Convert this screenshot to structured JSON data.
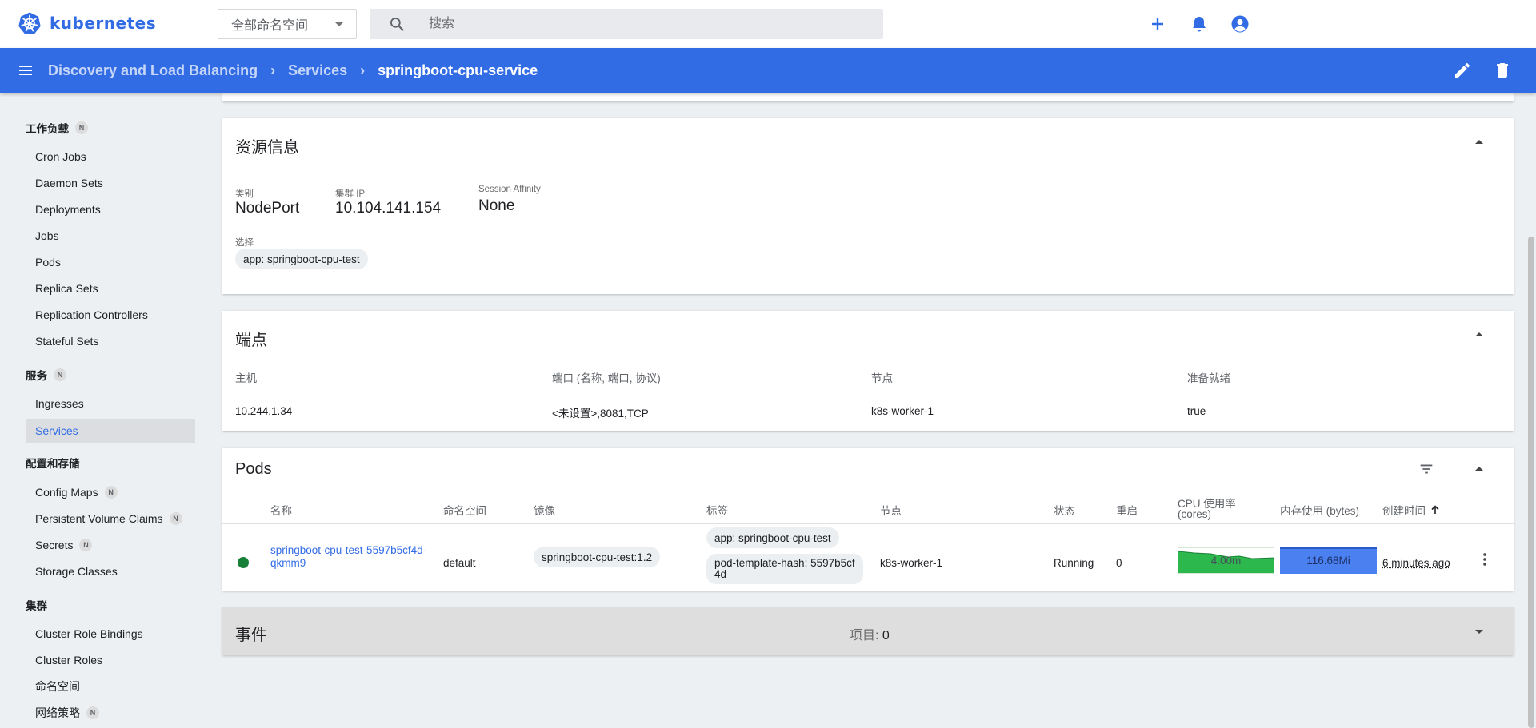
{
  "app": {
    "logo_text": "kubernetes"
  },
  "topbar": {
    "namespace_select": "全部命名空间",
    "search_placeholder": "搜索"
  },
  "breadcrumb": {
    "items": [
      "Discovery and Load Balancing",
      "Services"
    ],
    "current": "springboot-cpu-service"
  },
  "sidebar": {
    "workloads": {
      "title": "工作负载",
      "badge": "N",
      "items": [
        "Cron Jobs",
        "Daemon Sets",
        "Deployments",
        "Jobs",
        "Pods",
        "Replica Sets",
        "Replication Controllers",
        "Stateful Sets"
      ]
    },
    "service": {
      "title": "服务",
      "badge": "N",
      "items": [
        "Ingresses",
        "Services"
      ],
      "active": "Services"
    },
    "config": {
      "title": "配置和存储",
      "items": [
        {
          "label": "Config Maps",
          "badge": "N"
        },
        {
          "label": "Persistent Volume Claims",
          "badge": "N"
        },
        {
          "label": "Secrets",
          "badge": "N"
        },
        {
          "label": "Storage Classes",
          "badge": ""
        }
      ]
    },
    "cluster": {
      "title": "集群",
      "items": [
        {
          "label": "Cluster Role Bindings",
          "badge": ""
        },
        {
          "label": "Cluster Roles",
          "badge": ""
        },
        {
          "label": "命名空间",
          "badge": ""
        },
        {
          "label": "网络策略",
          "badge": "N"
        }
      ]
    }
  },
  "resource": {
    "title": "资源信息",
    "type_label": "类别",
    "type_value": "NodePort",
    "cluster_ip_label": "集群 IP",
    "cluster_ip_value": "10.104.141.154",
    "affinity_label": "Session Affinity",
    "affinity_value": "None",
    "selector_label": "选择",
    "selector_chip": "app: springboot-cpu-test"
  },
  "endpoints": {
    "title": "端点",
    "headers": [
      "主机",
      "端口 (名称, 端口, 协议)",
      "节点",
      "准备就绪"
    ],
    "row": [
      "10.244.1.34",
      "<未设置>,8081,TCP",
      "k8s-worker-1",
      "true"
    ]
  },
  "pods": {
    "title": "Pods",
    "headers": {
      "name": "名称",
      "namespace": "命名空间",
      "image": "镜像",
      "labels": "标签",
      "node": "节点",
      "status": "状态",
      "restarts": "重启",
      "cpu_line1": "CPU 使用率",
      "cpu_line2": "(cores)",
      "memory": "内存使用 (bytes)",
      "created": "创建时间"
    },
    "row": {
      "name_line1": "springboot-cpu-test-5597b5cf4d-",
      "name_line2": "qkmm9",
      "namespace": "default",
      "image": "springboot-cpu-test:1.2",
      "label1": "app: springboot-cpu-test",
      "label2_line1": "pod-template-hash: 5597b5cf",
      "label2_line2": "4d",
      "node": "k8s-worker-1",
      "status": "Running",
      "restarts": "0",
      "cpu": "4.00m",
      "memory": "116.68Mi",
      "created": "6 minutes ago"
    },
    "colors": {
      "running": "#188038",
      "cpu_fill": "#2db84d",
      "memory_fill": "#326ce5"
    }
  },
  "events": {
    "title": "事件",
    "count_label": "项目:",
    "count_value": "0"
  }
}
